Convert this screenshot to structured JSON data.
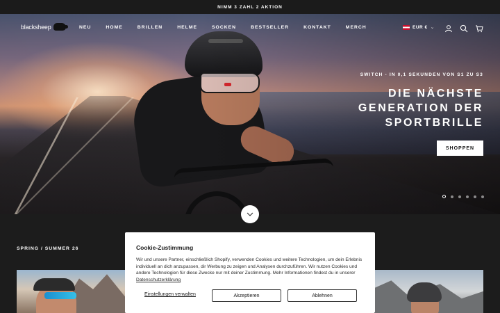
{
  "announcement": {
    "text": "NIMM 3 ZAHL 2 AKTION"
  },
  "header": {
    "logo_text": "blacksheep",
    "nav": [
      "NEU",
      "HOME",
      "BRILLEN",
      "HELME",
      "SOCKEN",
      "BESTSELLER",
      "KONTAKT",
      "MERCH"
    ],
    "currency": "EUR €",
    "icons": [
      "account-icon",
      "search-icon",
      "cart-icon"
    ]
  },
  "hero": {
    "eyebrow": "SWITCH - IN 0,1 SEKUNDEN VON S1 ZU S3",
    "title_line1": "DIE NÄCHSTE",
    "title_line2": "GENERATION DER",
    "title_line3": "SPORTBRILLE",
    "cta": "SHOPPEN",
    "slides_count": 6,
    "active_slide": 1
  },
  "collection": {
    "label": "SPRING / SUMMER 26"
  },
  "cookie": {
    "title": "Cookie-Zustimmung",
    "text": "Wir und unsere Partner, einschließlich Shopify, verwenden Cookies und weitere Technologien, um dein Erlebnis individuell an dich anzupassen, dir Werbung zu zeigen und Analysen durchzuführen. Wir nutzen Cookies und andere Technologien für diese Zwecke nur mit deiner Zustimmung. Mehr Informationen findest du in unserer",
    "link": "Datenschutzerklärung",
    "manage": "Einstellungen verwalten",
    "accept": "Akzeptieren",
    "decline": "Ablehnen"
  },
  "colors": {
    "dark": "#1b1b1b",
    "white": "#ffffff"
  }
}
